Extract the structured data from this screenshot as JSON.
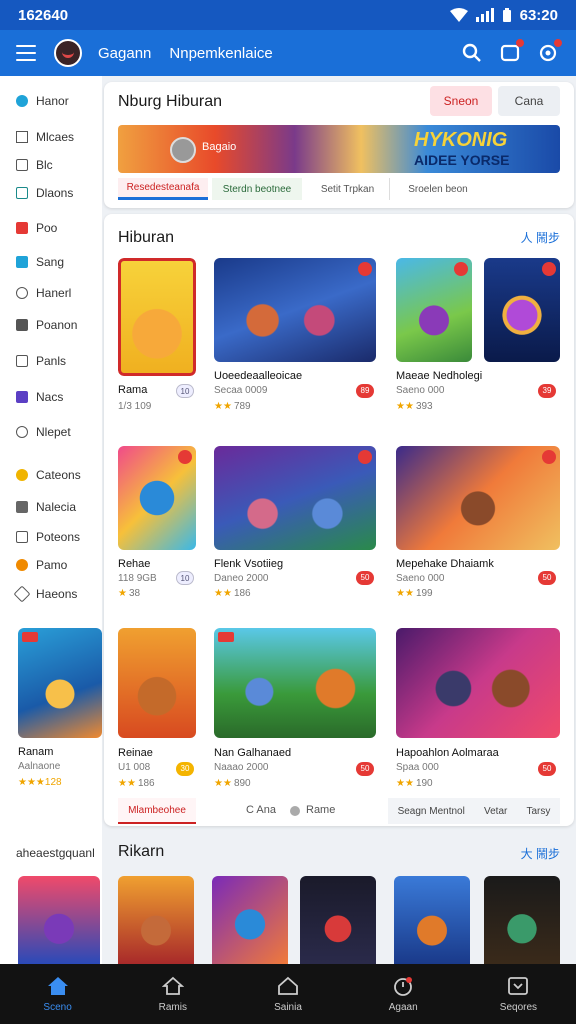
{
  "status": {
    "time": "162640",
    "clock": "63:20"
  },
  "appbar": {
    "title1": "Gagann",
    "title2": "Nnpemkenlaice"
  },
  "sidebar": {
    "items": [
      {
        "label": "Hanor",
        "icon": "home-icon"
      },
      {
        "label": "Mlcaes",
        "icon": "triangle-icon"
      },
      {
        "label": "Blc",
        "icon": "square-icon"
      },
      {
        "label": "Dlaons",
        "icon": "grid-icon"
      },
      {
        "label": "Poo",
        "icon": "red-square-icon"
      },
      {
        "label": "Sang",
        "icon": "teal-square-icon"
      },
      {
        "label": "Hanerl",
        "icon": "search-icon"
      },
      {
        "label": "Poanon",
        "icon": "box-icon"
      },
      {
        "label": "Panls",
        "icon": "shuffle-icon"
      },
      {
        "label": "Nacs",
        "icon": "purple-square-icon"
      },
      {
        "label": "Nlepet",
        "icon": "wand-icon"
      },
      {
        "label": "Cateons",
        "icon": "coin-icon"
      },
      {
        "label": "Nalecia",
        "icon": "lock-icon"
      },
      {
        "label": "Poteons",
        "icon": "calendar-icon"
      },
      {
        "label": "Pamo",
        "icon": "gift-icon"
      },
      {
        "label": "Haeons",
        "icon": "link-icon"
      }
    ],
    "promo": {
      "caption": "Ranam",
      "sub": "Aalnaone",
      "rating": "★★★128"
    }
  },
  "top_card": {
    "title": "Nburg Hiburan",
    "btn_primary": "Sneon",
    "btn_secondary": "Cana",
    "banner_left": "Bagaio",
    "banner_title": "HYKONIG",
    "banner_sub": "AIDEE YORSE",
    "tabs": [
      "Resedesteanafa",
      "Sterdn beotnee",
      "Setit Trpkan",
      "Sroelen beon"
    ]
  },
  "main_card": {
    "title": "Hiburan",
    "more": "人 鬧步",
    "footer_tabs": [
      "Mlambeohee",
      "C Ana",
      "Rame",
      "Seagn Mentnol",
      "Vetar",
      "Tarsy"
    ]
  },
  "tiles": [
    {
      "title": "Rama",
      "sub": "1/3 109",
      "stars": "",
      "rating": "",
      "pill": "10"
    },
    {
      "title": "Uoeedeaalleoicae",
      "sub": "Secaa 0009",
      "stars": "★★",
      "rating": "789",
      "pill": "89"
    },
    {
      "title": "Maeae Nedholegi",
      "sub": "Saeno 000",
      "stars": "★★",
      "rating": "393",
      "pill": "39"
    },
    {
      "title": "Rehae",
      "sub": "118 9GB",
      "stars": "★",
      "rating": "38",
      "pill": "10"
    },
    {
      "title": "Flenk Vsotiieg",
      "sub": "Daneo 2000",
      "stars": "★★",
      "rating": "186",
      "pill": "50"
    },
    {
      "title": "Mepehake Dhaiamk",
      "sub": "Saeno 000",
      "stars": "★★",
      "rating": "199",
      "pill": "50"
    },
    {
      "title": "Reinae",
      "sub": "U1 008",
      "stars": "★★",
      "rating": "186",
      "pill": "30"
    },
    {
      "title": "Nan Galhanaed",
      "sub": "Naaao 2000",
      "stars": "★★",
      "rating": "890",
      "pill": "50"
    },
    {
      "title": "Hapoahlon Aolmaraa",
      "sub": "Spaa 000",
      "stars": "★★",
      "rating": "190",
      "pill": "50"
    }
  ],
  "second_section": {
    "left_label": "aheaestgquanl",
    "title": "Rikarn",
    "more": "大 鬧步"
  },
  "bottom_nav": [
    "Sceno",
    "Ramis",
    "Sainia",
    "Agaan",
    "Seqores"
  ],
  "colors": {
    "appbar": "#1a6fd8",
    "accent": "#e53935",
    "nav": "#121212"
  }
}
